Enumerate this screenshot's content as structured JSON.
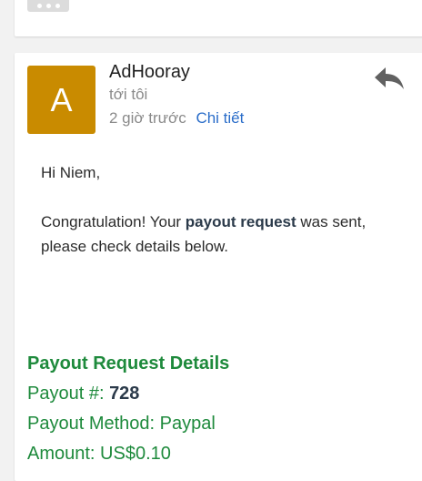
{
  "email": {
    "sender": "AdHooray",
    "avatar_letter": "A",
    "recipient": "tới tôi",
    "time": "2 giờ trước",
    "details_link": "Chi tiết",
    "greeting": "Hi Niem,",
    "body_before": "Congratulation! Your ",
    "body_bold": "payout request",
    "body_after": " was sent, please check details below."
  },
  "payout": {
    "title": "Payout Request Details",
    "number_label": "Payout #: ",
    "number_value": "728",
    "method": "Payout Method: Paypal",
    "amount": "Amount: US$0.10"
  },
  "icons": {
    "reply": "reply-icon",
    "more": "more-dots-icon"
  },
  "colors": {
    "avatar": "#c98b00",
    "link": "#2a6dc9",
    "payout_green": "#1e8a3c"
  }
}
